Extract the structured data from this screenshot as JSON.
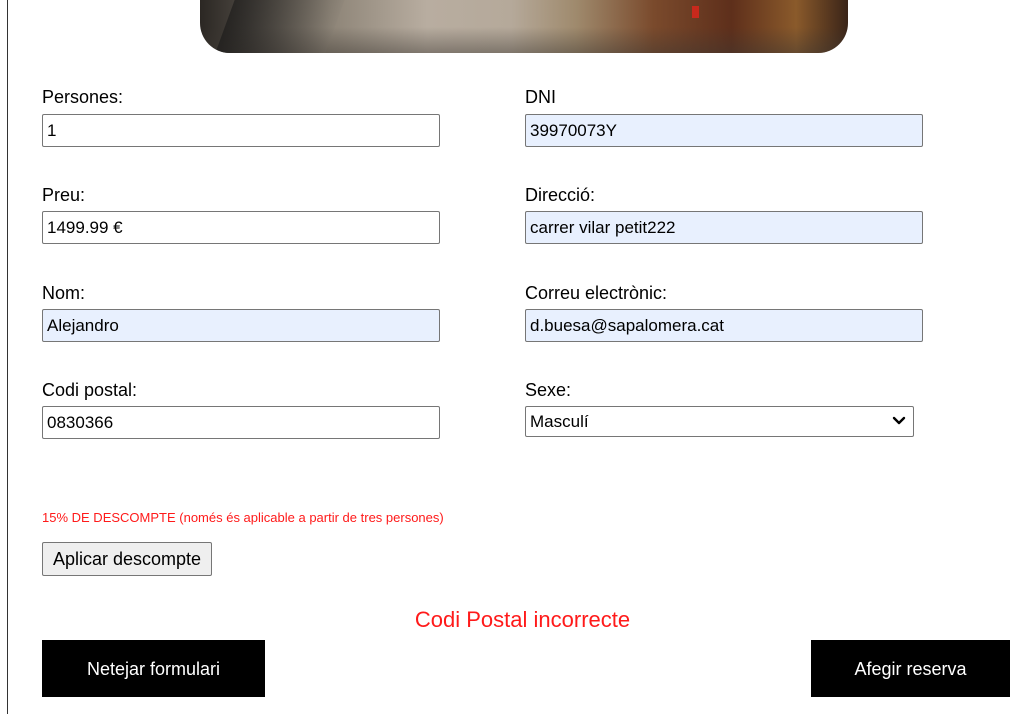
{
  "form": {
    "persones": {
      "label": "Persones:",
      "value": "1"
    },
    "dni": {
      "label": "DNI",
      "value": "39970073Y"
    },
    "preu": {
      "label": "Preu:",
      "value": "1499.99 €"
    },
    "direccio": {
      "label": "Direcció:",
      "value": "carrer vilar petit222"
    },
    "nom": {
      "label": "Nom:",
      "value": "Alejandro"
    },
    "correu": {
      "label": "Correu electrònic:",
      "value": "d.buesa@sapalomera.cat"
    },
    "codi_postal": {
      "label": "Codi postal:",
      "value": "0830366"
    },
    "sexe": {
      "label": "Sexe:",
      "selected": "Masculí"
    }
  },
  "discount": {
    "note": "15% DE DESCOMPTE (només és aplicable a partir de tres persones)",
    "button_label": "Aplicar descompte"
  },
  "error_message": "Codi Postal incorrecte",
  "actions": {
    "clear_label": "Netejar formulari",
    "add_label": "Afegir reserva"
  },
  "colors": {
    "error": "#ff1a1a",
    "autofill_bg": "#e8f0fe",
    "button_bg": "#000000",
    "button_text": "#ffffff"
  },
  "icons": {
    "select_arrow": "chevron-down-icon"
  }
}
